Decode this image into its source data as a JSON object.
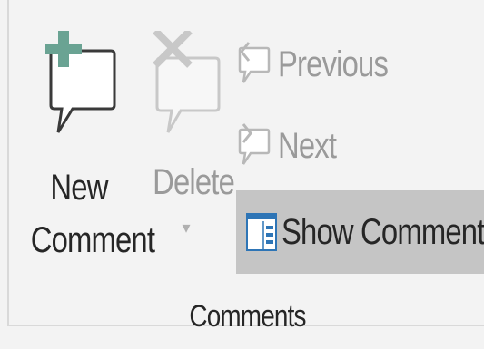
{
  "group": {
    "label": "Comments"
  },
  "buttons": {
    "new_comment": {
      "line1": "New",
      "line2": "Comment",
      "icon": "new-comment-icon"
    },
    "delete": {
      "line1": "Delete",
      "dropdown": "▾",
      "icon": "delete-comment-icon",
      "enabled": false
    },
    "previous": {
      "label": "Previous",
      "icon": "previous-comment-icon",
      "enabled": false
    },
    "next": {
      "label": "Next",
      "icon": "next-comment-icon",
      "enabled": false
    },
    "show_comments": {
      "label": "Show Comments",
      "icon": "show-comments-icon",
      "selected": true
    }
  },
  "colors": {
    "accent_green": "#6aa393",
    "selected_bg": "#c5c5c5",
    "disabled_text": "#9a9a9a",
    "icon_blue": "#2e75b6"
  }
}
